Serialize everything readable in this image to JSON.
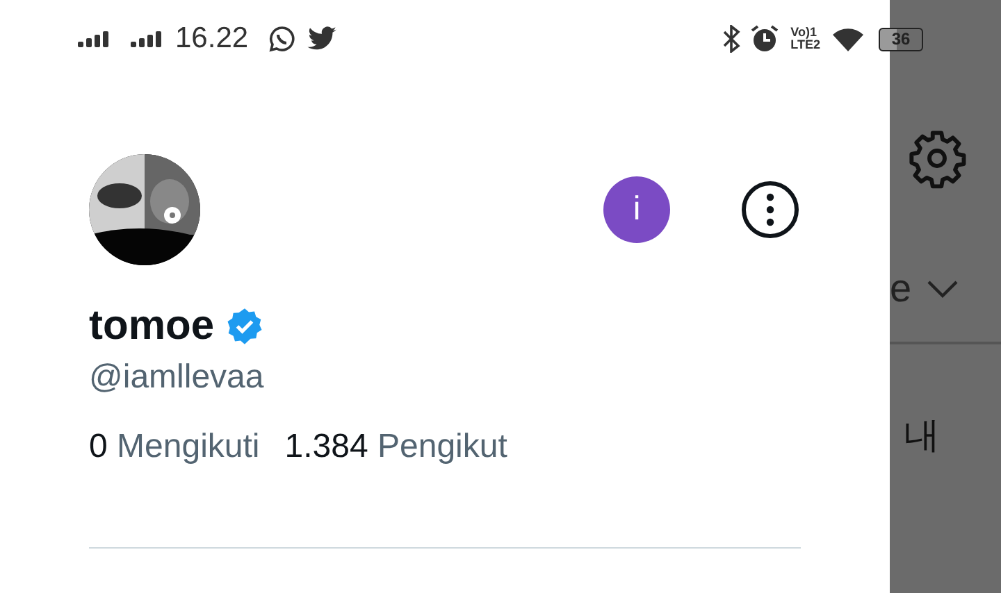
{
  "status_bar": {
    "time": "16.22",
    "volte": [
      "Vo)1",
      "LTE2"
    ],
    "battery": "36"
  },
  "profile": {
    "name": "tomoe",
    "verified": true,
    "handle": "@iamllevaa",
    "switch_account_label": "i",
    "stats": [
      {
        "count": "0",
        "label": "Mengikuti"
      },
      {
        "count": "1.384",
        "label": "Pengikut"
      }
    ]
  },
  "backdrop": {
    "cut_text": "e",
    "korean_text": "내"
  }
}
